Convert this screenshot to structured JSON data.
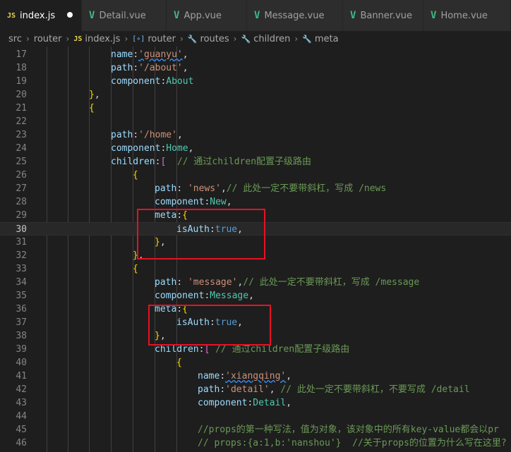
{
  "tabs": [
    {
      "label": "index.js",
      "icon": "js",
      "active": true,
      "modified": true
    },
    {
      "label": "Detail.vue",
      "icon": "vue"
    },
    {
      "label": "App.vue",
      "icon": "vue"
    },
    {
      "label": "Message.vue",
      "icon": "vue"
    },
    {
      "label": "Banner.vue",
      "icon": "vue"
    },
    {
      "label": "Home.vue",
      "icon": "vue"
    }
  ],
  "breadcrumb": [
    "src",
    "router",
    "index.js",
    "router",
    "routes",
    "children",
    "meta"
  ],
  "icons": {
    "js": "JS",
    "vue": "V",
    "module": "[∘]",
    "wrench": "🔧"
  },
  "lines": [
    {
      "n": "17",
      "t": "name:'guanyu',"
    },
    {
      "n": "18",
      "t": "path:'/about',"
    },
    {
      "n": "19",
      "t": "component:About"
    },
    {
      "n": "20",
      "t": "},"
    },
    {
      "n": "21",
      "t": "{"
    },
    {
      "n": "22",
      "t": ""
    },
    {
      "n": "23",
      "t": "path:'/home',"
    },
    {
      "n": "24",
      "t": "component:Home,"
    },
    {
      "n": "25",
      "t": "children:[  // 通过children配置子级路由"
    },
    {
      "n": "26",
      "t": "{"
    },
    {
      "n": "27",
      "t": "path: 'news',// 此处一定不要带斜杠，写成 /news"
    },
    {
      "n": "28",
      "t": "component:New,"
    },
    {
      "n": "29",
      "t": "meta:{"
    },
    {
      "n": "30",
      "t": "isAuth:true,"
    },
    {
      "n": "31",
      "t": "},"
    },
    {
      "n": "32",
      "t": "},"
    },
    {
      "n": "33",
      "t": "{"
    },
    {
      "n": "34",
      "t": "path: 'message',// 此处一定不要带斜杠，写成 /message"
    },
    {
      "n": "35",
      "t": "component:Message,"
    },
    {
      "n": "36",
      "t": "meta:{"
    },
    {
      "n": "37",
      "t": "isAuth:true,"
    },
    {
      "n": "38",
      "t": "},"
    },
    {
      "n": "39",
      "t": "children:[ // 通过children配置子级路由"
    },
    {
      "n": "40",
      "t": "{"
    },
    {
      "n": "41",
      "t": "name:'xiangqing',"
    },
    {
      "n": "42",
      "t": "path:'detail', // 此处一定不要带斜杠，不要写成 /detail"
    },
    {
      "n": "43",
      "t": "component:Detail,"
    },
    {
      "n": "44",
      "t": ""
    },
    {
      "n": "45",
      "t": "//props的第一种写法，值为对象，该对象中的所有key-value都会以pr"
    },
    {
      "n": "46",
      "t": "// props:{a:1,b:'nanshou'}  //关于props的位置为什么写在这里?"
    }
  ],
  "current_line": "30",
  "colors": {
    "highlight_box": "#e81123",
    "editor_bg": "#1e1e1e",
    "tab_bg": "#2d2d2d"
  }
}
